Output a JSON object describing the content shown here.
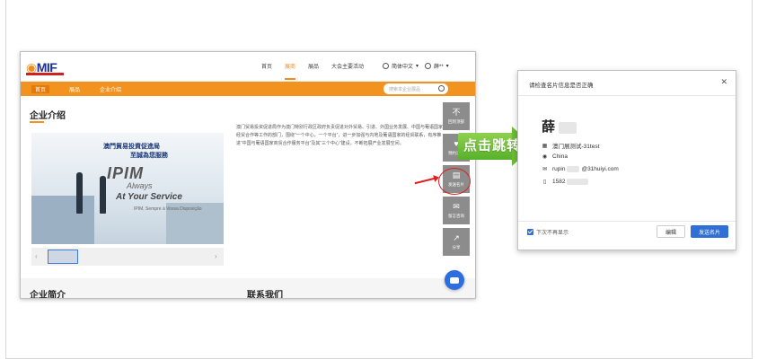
{
  "site": {
    "logo_text": "MIF",
    "top_nav": [
      "首页",
      "展商",
      "展品",
      "大会主要活动"
    ],
    "top_nav_active_index": 1,
    "language": "简体中文",
    "user_name": "薛**",
    "sub_nav": [
      "首页",
      "展品",
      "企业介绍"
    ],
    "search_placeholder": "搜索本企业展品",
    "section_title": "企业介绍",
    "banner": {
      "zh_line1": "澳門貿易投資促進局",
      "zh_line2": "至誠為您服務",
      "brand": "IPIM",
      "tagline1": "Always",
      "tagline2": "At Your Service",
      "tagline_pt": "IPIM, Sempre à Vossa Disposição"
    },
    "intro_text": "澳门贸易投资促进局作为澳门特别行政区政府负责促进对外贸易、引进、外国业务发展、中国与葡语国家经贸合作等工作的部门，围绕“一个中心，一个平台”，进一步加强与内地及葡语国家的经贸联系，有序推进“中国与葡语国家商贸合作服务平台”及其“三个中心”建设，不断拓展产业发展空间。",
    "tools": [
      {
        "icon": "不",
        "label": "回到顶部"
      },
      {
        "icon": "♥",
        "label": "预约洽谈"
      },
      {
        "icon": "▤",
        "label": "发送名片"
      },
      {
        "icon": "✉",
        "label": "留言咨询"
      },
      {
        "icon": "↗",
        "label": "分享"
      }
    ],
    "bottom_left": "企业简介",
    "bottom_right": "联系我们"
  },
  "callout": {
    "label": "点击跳转",
    "color": "#6cbd33"
  },
  "modal": {
    "title": "请检查名片信息是否正确",
    "name": "薛",
    "company": "澳门展测试-31test",
    "country": "China",
    "email_prefix": "rupin",
    "email_suffix": "@31huiyi.com",
    "phone_prefix": "1582",
    "dont_show_label": "下次不再显示",
    "edit_label": "编辑",
    "send_label": "发送名片",
    "accent_color": "#2f6fd6"
  }
}
